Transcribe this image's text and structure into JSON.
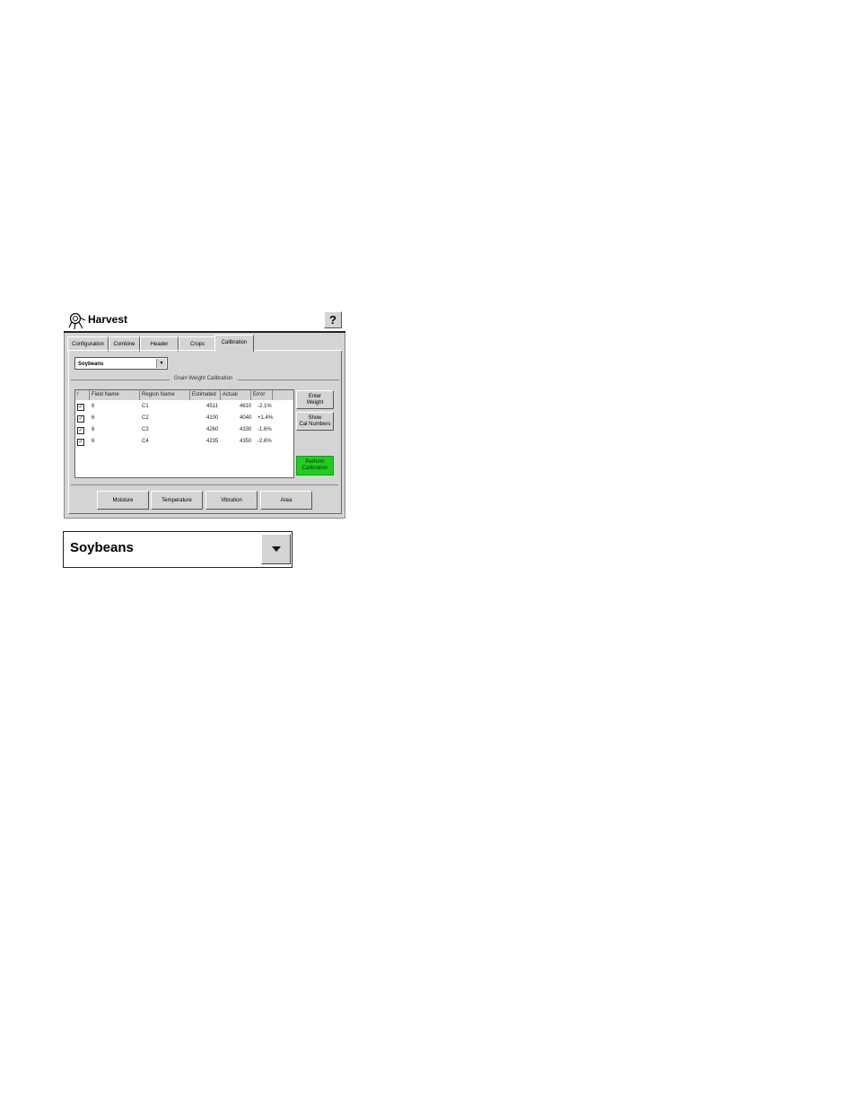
{
  "window": {
    "title": "Harvest",
    "help_label": "?"
  },
  "tabs": [
    {
      "label": "Configuration"
    },
    {
      "label": "Combine"
    },
    {
      "label": "Header"
    },
    {
      "label": "Crops"
    },
    {
      "label": "Calibration",
      "active": true
    }
  ],
  "crop_select": {
    "value": "Soybeans"
  },
  "group_title": "Grain Weight Calibration",
  "table": {
    "headers": [
      "!",
      "Field Name",
      "Region Name",
      "Estimated",
      "Actual",
      "Error"
    ],
    "rows": [
      {
        "checked": true,
        "field": "6",
        "region": "C1",
        "estimated": "4511",
        "actual": "4610",
        "error": "-2.1%"
      },
      {
        "checked": true,
        "field": "6",
        "region": "C2",
        "estimated": "4100",
        "actual": "4040",
        "error": "+1.4%"
      },
      {
        "checked": true,
        "field": "6",
        "region": "C3",
        "estimated": "4260",
        "actual": "4330",
        "error": "-1.6%"
      },
      {
        "checked": true,
        "field": "6",
        "region": "C4",
        "estimated": "4235",
        "actual": "4350",
        "error": "-2.6%"
      }
    ]
  },
  "side_buttons": {
    "enter_weight": [
      "Enter",
      "Weight"
    ],
    "show_cal_numbers": [
      "Show",
      "Cal Numbers"
    ],
    "perform_calibration": [
      "Perform",
      "Calibration"
    ]
  },
  "bottom_buttons": [
    "Moisture",
    "Temperature",
    "Vibration",
    "Area"
  ],
  "zoom_callout": {
    "value": "Soybeans"
  },
  "colors": {
    "perform_button": "#22cc22",
    "panel_bg": "#d4d4d4"
  }
}
